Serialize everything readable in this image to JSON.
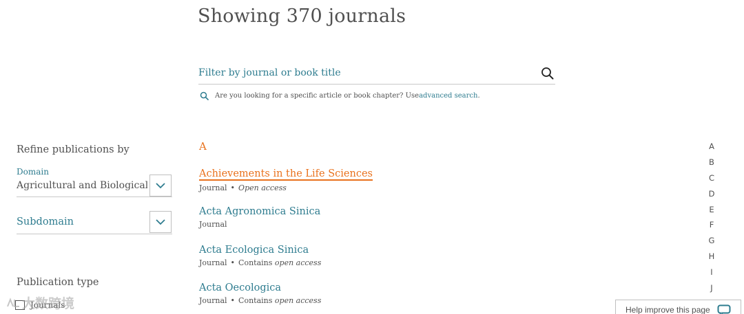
{
  "header": {
    "title": "Showing 370 journals"
  },
  "search": {
    "placeholder": "Filter by journal or book title",
    "hint_text": "Are you looking for a specific article or book chapter? Use ",
    "hint_link": "advanced search",
    "hint_end": "."
  },
  "sidebar": {
    "refine_title": "Refine publications by",
    "domain_label": "Domain",
    "domain_value": "Agricultural and Biological Sciences",
    "subdomain_label": "Subdomain",
    "pubtype_title": "Publication type",
    "journals_label": "Journals"
  },
  "list": {
    "letter": "A",
    "journals": [
      {
        "title": "Achievements in the Life Sciences",
        "type": "Journal",
        "access_prefix": "",
        "access": "Open access"
      },
      {
        "title": "Acta Agronomica Sinica",
        "type": "Journal",
        "access_prefix": "",
        "access": ""
      },
      {
        "title": "Acta Ecologica Sinica",
        "type": "Journal",
        "access_prefix": "Contains ",
        "access": "open access"
      },
      {
        "title": "Acta Oecologica",
        "type": "Journal",
        "access_prefix": "Contains ",
        "access": "open access"
      }
    ]
  },
  "alpha_nav": [
    "A",
    "B",
    "C",
    "D",
    "E",
    "F",
    "G",
    "H",
    "I",
    "J"
  ],
  "feedback": {
    "label": "Help improve this page"
  },
  "watermark": {
    "text": "大数跨境"
  },
  "colors": {
    "accent": "#2e7c8f",
    "active": "#e9711c",
    "text": "#505050"
  }
}
